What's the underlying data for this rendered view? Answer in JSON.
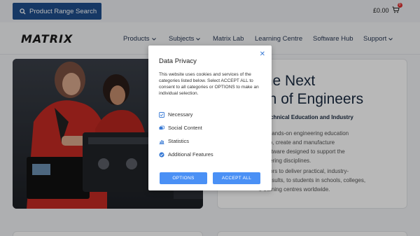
{
  "topbar": {
    "search_label": "Product Range Search",
    "cart_total": "£0.00",
    "cart_count": "0"
  },
  "nav": {
    "logo": "MATRIX",
    "items": [
      {
        "label": "Products",
        "has_dropdown": true
      },
      {
        "label": "Subjects",
        "has_dropdown": true
      },
      {
        "label": "Matrix Lab",
        "has_dropdown": false
      },
      {
        "label": "Learning Centre",
        "has_dropdown": false
      },
      {
        "label": "Software Hub",
        "has_dropdown": false
      },
      {
        "label": "Support",
        "has_dropdown": true
      }
    ]
  },
  "hero": {
    "title_line1": "the Next",
    "title_line2": "on of Engineers",
    "subtitle": "r Technical Education and Industry",
    "paragraph1": [
      "r of hands-on engineering education",
      "velop, create and manufacture",
      "d software designed to support the",
      "gineering disciplines."
    ],
    "paragraph2": [
      "ucators to deliver practical, industry-",
      "ed results, to students in schools, colleges,",
      "ir training centres worldwide."
    ]
  },
  "modal": {
    "title": "Data Privacy",
    "close_symbol": "✕",
    "description": "This website uses cookies and services of the categories listed below. Select ACCEPT ALL to consent to all categories or OPTIONS to make an individual selection.",
    "categories": [
      {
        "label": "Necessary",
        "icon": "check-square-icon"
      },
      {
        "label": "Social Content",
        "icon": "users-icon"
      },
      {
        "label": "Statistics",
        "icon": "bar-chart-icon"
      },
      {
        "label": "Additional Features",
        "icon": "badge-check-icon"
      }
    ],
    "options_label": "OPTIONS",
    "accept_label": "ACCEPT ALL"
  },
  "colors": {
    "search_button": "#1f4e8c",
    "modal_button": "#4a90f5",
    "icon_blue": "#3a7bd5"
  }
}
